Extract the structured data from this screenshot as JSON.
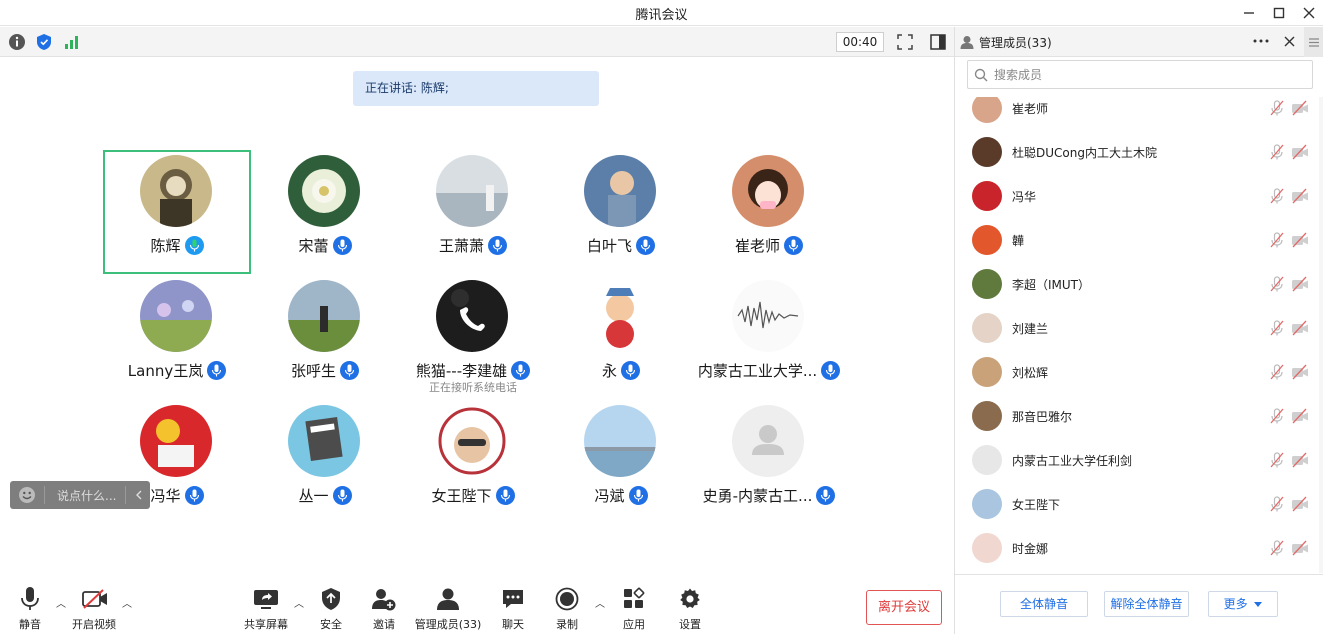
{
  "window": {
    "title": "腾讯会议"
  },
  "toolbar": {
    "timer": "00:40"
  },
  "speaking": {
    "text": "正在讲话: 陈辉;"
  },
  "participants": [
    {
      "name": "陈辉",
      "active": true
    },
    {
      "name": "宋蕾"
    },
    {
      "name": "王萧萧"
    },
    {
      "name": "白叶飞"
    },
    {
      "name": "崔老师"
    },
    {
      "name": "Lanny王岚"
    },
    {
      "name": "张呼生"
    },
    {
      "name": "熊猫---李建雄",
      "note": "正在接听系统电话"
    },
    {
      "name": "永"
    },
    {
      "name": "内蒙古工业大学..."
    },
    {
      "name": "冯华"
    },
    {
      "name": "丛一"
    },
    {
      "name": "女王陛下"
    },
    {
      "name": "冯斌"
    },
    {
      "name": "史勇-内蒙古工..."
    }
  ],
  "chat": {
    "placeholder": "说点什么..."
  },
  "bottombar": {
    "mute": "静音",
    "video": "开启视频",
    "share": "共享屏幕",
    "security": "安全",
    "invite": "邀请",
    "members": "管理成员(33)",
    "chat": "聊天",
    "record": "录制",
    "apps": "应用",
    "settings": "设置",
    "leave": "离开会议"
  },
  "panel": {
    "title": "管理成员(33)",
    "search_placeholder": "搜索成员",
    "members": [
      {
        "name": "崔老师"
      },
      {
        "name": "杜聪DUCong内工大土木院"
      },
      {
        "name": "冯华"
      },
      {
        "name": "韡"
      },
      {
        "name": "李超（IMUT）"
      },
      {
        "name": "刘建兰"
      },
      {
        "name": "刘松辉"
      },
      {
        "name": "那音巴雅尔"
      },
      {
        "name": "内蒙古工业大学任利剑"
      },
      {
        "name": "女王陛下"
      },
      {
        "name": "时金娜"
      }
    ],
    "mute_all": "全体静音",
    "unmute_all": "解除全体静音",
    "more": "更多"
  },
  "colors": {
    "accent": "#1f6fe5",
    "active_border": "#3bbf7a",
    "leave": "#e03b3b"
  }
}
